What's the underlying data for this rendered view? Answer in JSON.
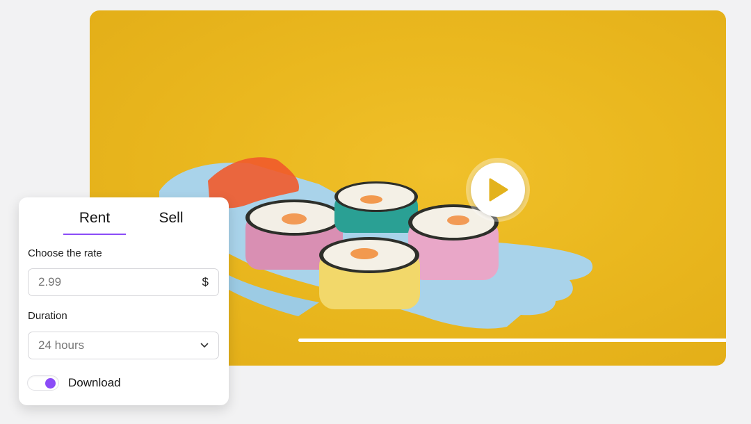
{
  "video": {
    "play_icon": "play-icon",
    "progress": 0
  },
  "panel": {
    "tabs": [
      {
        "label": "Rent",
        "active": true
      },
      {
        "label": "Sell",
        "active": false
      }
    ],
    "rate": {
      "label": "Choose the rate",
      "placeholder": "2.99",
      "currency": "$"
    },
    "duration": {
      "label": "Duration",
      "value": "24 hours",
      "icon": "chevron-down-icon"
    },
    "download": {
      "label": "Download",
      "enabled": true
    }
  },
  "colors": {
    "accent": "#8b4cf7",
    "video_background": "#eab81f"
  }
}
